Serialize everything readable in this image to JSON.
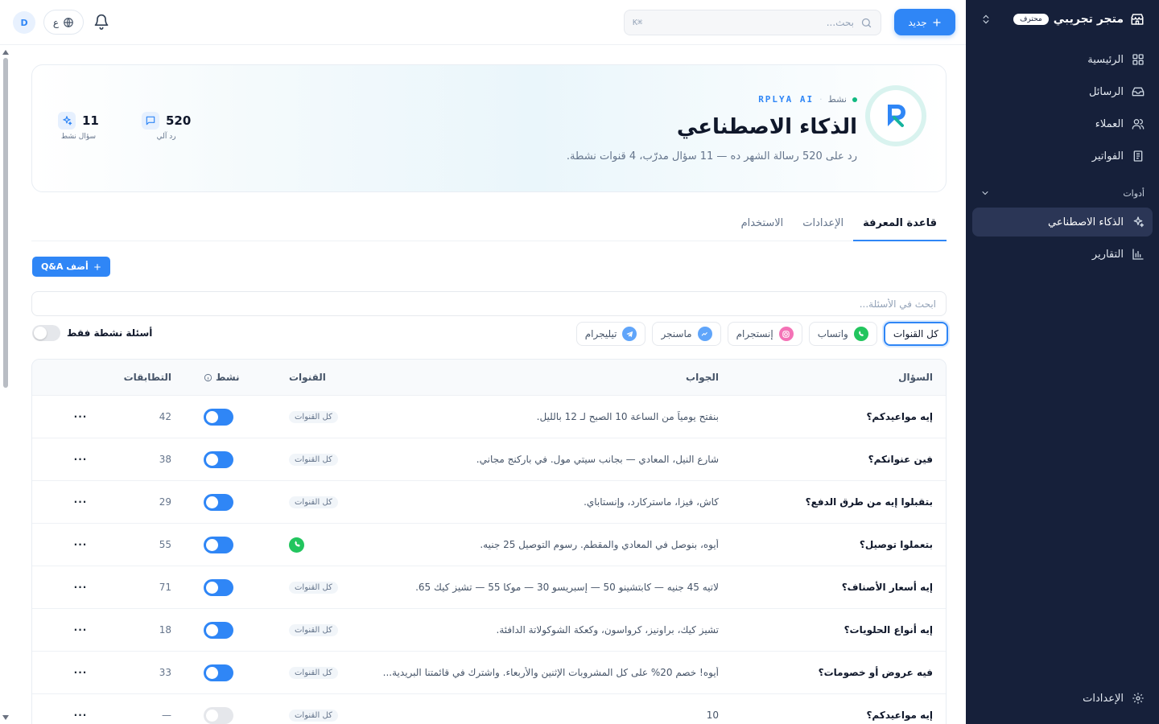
{
  "sidebar": {
    "store_name": "متجر تجريبي",
    "plan_badge": "محترف",
    "items": [
      {
        "label": "الرئيسية",
        "icon": "dashboard-grid-icon"
      },
      {
        "label": "الرسائل",
        "icon": "inbox-icon"
      },
      {
        "label": "العملاء",
        "icon": "users-icon"
      },
      {
        "label": "الفواتير",
        "icon": "invoice-icon"
      }
    ],
    "section_label": "أدوات",
    "tools": [
      {
        "label": "الذكاء الاصطناعي",
        "icon": "sparkles-icon",
        "active": true
      },
      {
        "label": "التقارير",
        "icon": "bar-chart-icon"
      }
    ],
    "settings_label": "الإعدادات"
  },
  "topbar": {
    "new_label": "جديد",
    "search_placeholder": "بحث...",
    "search_shortcut": "⌘K",
    "lang_label": "ع",
    "avatar_initial": "D"
  },
  "hero": {
    "status": "نشط",
    "brand": "RPLYA AI",
    "title": "الذكاء الاصطناعي",
    "subtitle": "رد على 520 رسالة الشهر ده — 11 سؤال مدرّب، 4 قنوات نشطة.",
    "stats": [
      {
        "value": "520",
        "label": "رد آلي",
        "icon": "message-square-icon"
      },
      {
        "value": "11",
        "label": "سؤال نشط",
        "icon": "sparkles-icon"
      }
    ]
  },
  "tabs": [
    {
      "label": "قاعدة المعرفة",
      "active": true
    },
    {
      "label": "الإعدادات",
      "active": false
    },
    {
      "label": "الاستخدام",
      "active": false
    }
  ],
  "add_qa_label": "أضف Q&A",
  "qa_search_placeholder": "ابحث في الأسئلة...",
  "channel_filters": [
    {
      "label": "كل القنوات",
      "active": true
    },
    {
      "label": "واتساب",
      "color": "#22c55e",
      "icon": "whatsapp-icon"
    },
    {
      "label": "إنستجرام",
      "color": "#ec4899",
      "icon": "instagram-icon"
    },
    {
      "label": "ماسنجر",
      "color": "#3b82f6",
      "icon": "messenger-icon"
    },
    {
      "label": "تيليجرام",
      "color": "#3b9be6",
      "icon": "telegram-icon"
    }
  ],
  "active_only_label": "أسئلة نشطة فقط",
  "table": {
    "headers": {
      "question": "السؤال",
      "answer": "الجواب",
      "channels": "القنوات",
      "active": "نشط",
      "uses": "التطابقات"
    },
    "rows": [
      {
        "q": "إيه مواعيدكم؟",
        "a": "بنفتح يومياً من الساعة 10 الصبح لـ 12 بالليل.",
        "ch": "كل القنوات",
        "on": true,
        "uses": "42"
      },
      {
        "q": "فين عنوانكم؟",
        "a": "شارع النيل، المعادي — بجانب سيتي مول. في باركنج مجاني.",
        "ch": "كل القنوات",
        "on": true,
        "uses": "38"
      },
      {
        "q": "بتقبلوا إيه من طرق الدفع؟",
        "a": "كاش، فيزا، ماستركارد، وإنستاباي.",
        "ch": "كل القنوات",
        "on": true,
        "uses": "29"
      },
      {
        "q": "بتعملوا توصيل؟",
        "a": "أيوه، بنوصل في المعادي والمقطم. رسوم التوصيل 25 جنيه.",
        "ch": "whatsapp",
        "on": true,
        "uses": "55"
      },
      {
        "q": "إيه أسعار الأصناف؟",
        "a": "لاتيه 45 جنيه — كابتشينو 50 — إسبريسو 30 — موكا 55 — تشيز كيك 65.",
        "ch": "كل القنوات",
        "on": true,
        "uses": "71"
      },
      {
        "q": "إيه أنواع الحلويات؟",
        "a": "تشيز كيك، براونيز، كرواسون، وكعكة الشوكولاتة الدافئة.",
        "ch": "كل القنوات",
        "on": true,
        "uses": "18"
      },
      {
        "q": "فيه عروض أو خصومات؟",
        "a": "أيوه! خصم 20% على كل المشروبات الإثنين والأربعاء. واشترك في قائمتنا البريدية...",
        "ch": "كل القنوات",
        "on": true,
        "uses": "33"
      },
      {
        "q": "إيه مواعيدكم؟",
        "a": "10",
        "ch": "كل القنوات",
        "on": false,
        "uses": "—"
      }
    ],
    "more_label": "···"
  }
}
